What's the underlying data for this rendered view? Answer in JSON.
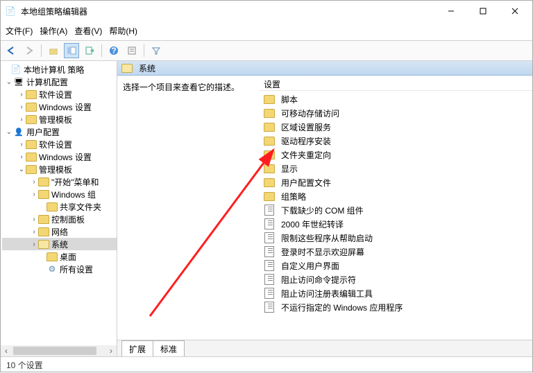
{
  "window": {
    "title": "本地组策略编辑器"
  },
  "menu": {
    "file": "文件(F)",
    "action": "操作(A)",
    "view": "查看(V)",
    "help": "帮助(H)"
  },
  "tree": {
    "root": "本地计算机 策略",
    "computer_cfg": "计算机配置",
    "c_software": "软件设置",
    "c_windows": "Windows 设置",
    "c_admin": "管理模板",
    "user_cfg": "用户配置",
    "u_software": "软件设置",
    "u_windows": "Windows 设置",
    "u_admin": "管理模板",
    "u_admin_start": "\"开始\"菜单和",
    "u_admin_wincomp": "Windows 组",
    "u_admin_shared": "共享文件夹",
    "u_admin_ctrl": "控制面板",
    "u_admin_net": "网络",
    "u_admin_sys": "系统",
    "u_admin_desk": "桌面",
    "u_admin_all": "所有设置"
  },
  "main": {
    "crumb": "系统",
    "desc_hint": "选择一个项目来查看它的描述。",
    "col_setting": "设置"
  },
  "settings": [
    {
      "type": "folder",
      "label": "脚本"
    },
    {
      "type": "folder",
      "label": "可移动存储访问"
    },
    {
      "type": "folder",
      "label": "区域设置服务"
    },
    {
      "type": "folder",
      "label": "驱动程序安装"
    },
    {
      "type": "folder",
      "label": "文件夹重定向"
    },
    {
      "type": "folder",
      "label": "显示"
    },
    {
      "type": "folder",
      "label": "用户配置文件"
    },
    {
      "type": "folder",
      "label": "组策略"
    },
    {
      "type": "policy",
      "label": "下载缺少的 COM 组件"
    },
    {
      "type": "policy",
      "label": "2000 年世纪转译"
    },
    {
      "type": "policy",
      "label": "限制这些程序从帮助启动"
    },
    {
      "type": "policy",
      "label": "登录时不显示欢迎屏幕"
    },
    {
      "type": "policy",
      "label": "自定义用户界面"
    },
    {
      "type": "policy",
      "label": "阻止访问命令提示符"
    },
    {
      "type": "policy",
      "label": "阻止访问注册表编辑工具"
    },
    {
      "type": "policy",
      "label": "不运行指定的 Windows 应用程序"
    }
  ],
  "tabs": {
    "extended": "扩展",
    "standard": "标准"
  },
  "status": {
    "text": "10 个设置"
  }
}
